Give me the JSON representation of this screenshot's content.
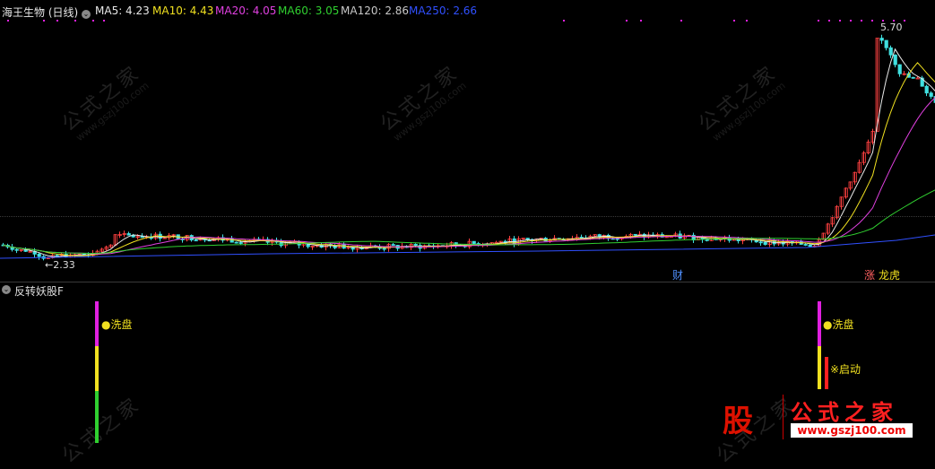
{
  "header": {
    "stock_title": "海王生物 (日线)",
    "ma": [
      {
        "label": "MA5: 4.23",
        "color": "#e8e8e8"
      },
      {
        "label": "MA10: 4.43",
        "color": "#f0e020"
      },
      {
        "label": "MA20: 4.05",
        "color": "#e040e0"
      },
      {
        "label": "MA60: 3.05",
        "color": "#30d030"
      },
      {
        "label": "MA120: 2.86",
        "color": "#c8c8c8"
      },
      {
        "label": "MA250: 2.66",
        "color": "#3050ff"
      }
    ]
  },
  "price_chart": {
    "high_label": "5.70",
    "low_label": "←2.33",
    "markers": {
      "cai": "财",
      "zhang": "涨",
      "long": "龙虎"
    },
    "colors": {
      "up": "#ff4040",
      "down": "#40e0e0",
      "ma5": "#e8e8e8",
      "ma10": "#f0e020",
      "ma20": "#e040e0",
      "ma60": "#30d030",
      "ma250": "#3050ff"
    }
  },
  "indicator": {
    "title": "反转妖股F",
    "signal_wash": "●洗盘",
    "signal_wash2": "●洗盘",
    "signal_start": "※启动",
    "colors": {
      "magenta": "#e020e0",
      "yellow": "#f0e020",
      "green": "#30d030",
      "red": "#ff2020"
    }
  },
  "watermark": {
    "cn": "公式之家",
    "url": "www.gszj100.com",
    "logo_cn": "公式之家",
    "logo_url": "www.gszj100.com",
    "logo_badge": "股"
  },
  "chart_data": {
    "type": "candlestick",
    "title": "海王生物 (日线)",
    "annotations": [
      "5.70",
      "2.33"
    ],
    "summary": {
      "high": 5.7,
      "low": 2.33
    }
  }
}
